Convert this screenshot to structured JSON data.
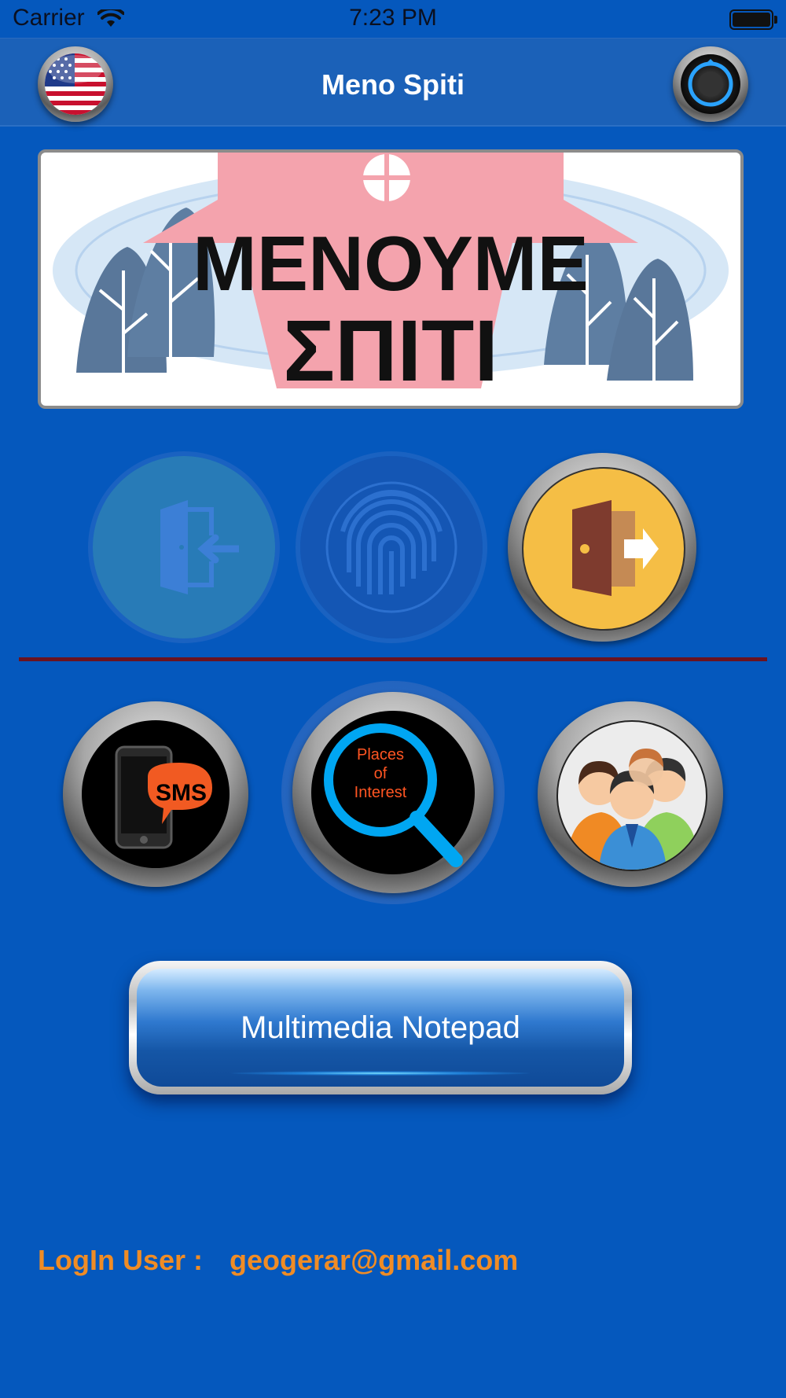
{
  "status_bar": {
    "carrier": "Carrier",
    "time": "7:23 PM"
  },
  "nav": {
    "title": "Meno Spiti"
  },
  "banner": {
    "line1": "ΜΕΝΟΥΜΕ",
    "line2": "ΣΠΙΤΙ"
  },
  "buttons": {
    "places_line1": "Places",
    "places_line2": "of",
    "places_line3": "Interest",
    "sms_label": "SMS",
    "multimedia_label": "Multimedia Notepad"
  },
  "login": {
    "label": "LogIn User :",
    "email": "geogerar@gmail.com"
  },
  "colors": {
    "background": "#0558bd",
    "accent_orange": "#f08c25",
    "divider": "#6b1320"
  },
  "icons": [
    "wifi-icon",
    "battery-icon",
    "us-flag-icon",
    "sync-dial-icon",
    "login-door-icon",
    "fingerprint-icon",
    "logout-door-icon",
    "sms-phone-icon",
    "search-magnifier-icon",
    "users-group-icon"
  ]
}
